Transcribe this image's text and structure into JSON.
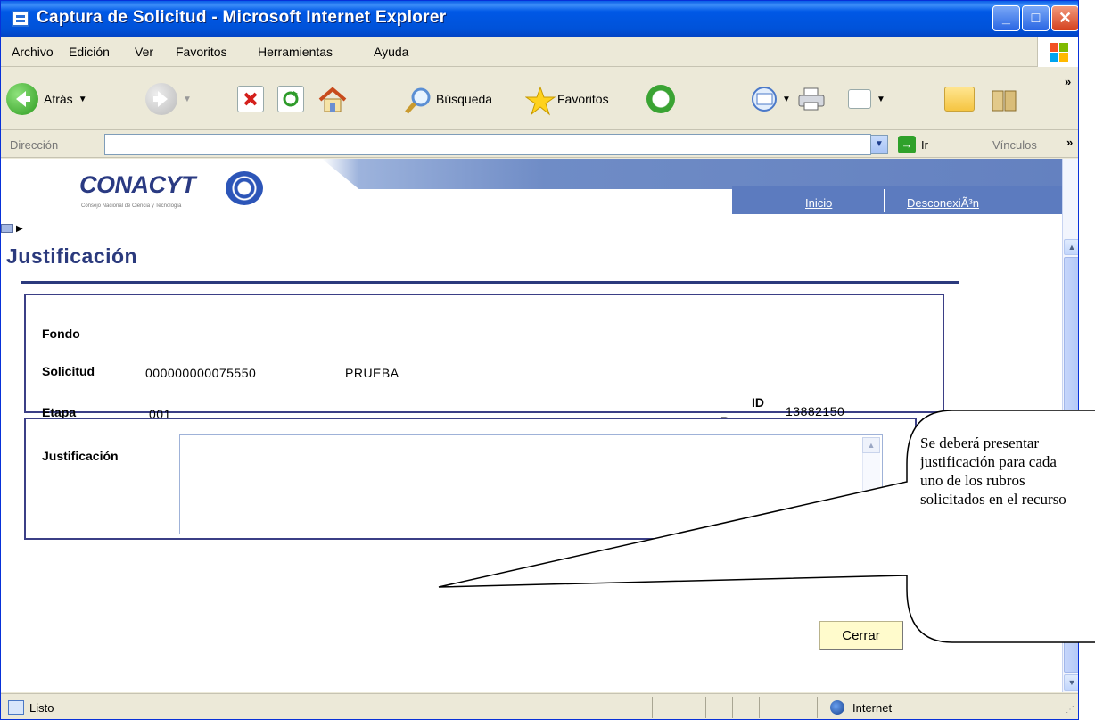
{
  "window": {
    "title": "Captura de Solicitud - Microsoft Internet Explorer",
    "minimize": "_",
    "maximize": "□",
    "close": "✕"
  },
  "menu": [
    "Archivo",
    "Edición",
    "Ver",
    "Favoritos",
    "Herramientas",
    "Ayuda"
  ],
  "toolbar": {
    "back": "Atrás",
    "search": "Búsqueda",
    "favorites": "Favoritos",
    "overflow": "»"
  },
  "address": {
    "label": "Dirección",
    "value": "",
    "go": "Ir",
    "links": "Vínculos",
    "overflow": "»"
  },
  "site": {
    "logo_text": "CONACYT",
    "logo_subtitle": "Consejo Nacional de Ciencia y Tecnología",
    "nav": [
      "Inicio",
      "DesconexiÃ³n"
    ]
  },
  "page": {
    "title": "Justificación",
    "fields": {
      "fondo_label": "Fondo",
      "solicitud_label": "Solicitud",
      "solicitud_number": "000000000075550",
      "solicitud_name": "PRUEBA",
      "etapa_label": "Etapa",
      "etapa_value": "001",
      "id_label": "ID",
      "recurso_label": "Recurso",
      "id_recurso_value": "13882150"
    },
    "justificacion_label": "Justificación",
    "justificacion_value": "",
    "close_button": "Cerrar"
  },
  "callout": {
    "lines": [
      "Se deberá presentar",
      "justificación para cada",
      "uno de los rubros",
      "solicitados en el recurso"
    ]
  },
  "status": {
    "text": "Listo",
    "zone": "Internet"
  },
  "colors": {
    "title_bar": "#0058e6",
    "heading": "#2b3a7d",
    "panel_border": "#3b3f86",
    "header_band": "#6481c0",
    "button_bg": "#fffbcc"
  },
  "icons": [
    "back-icon",
    "forward-icon",
    "stop-icon",
    "refresh-icon",
    "home-icon",
    "search-icon",
    "favorites-icon",
    "history-icon",
    "mail-icon",
    "print-icon",
    "edit-icon",
    "folder-icon",
    "messenger-icon"
  ]
}
